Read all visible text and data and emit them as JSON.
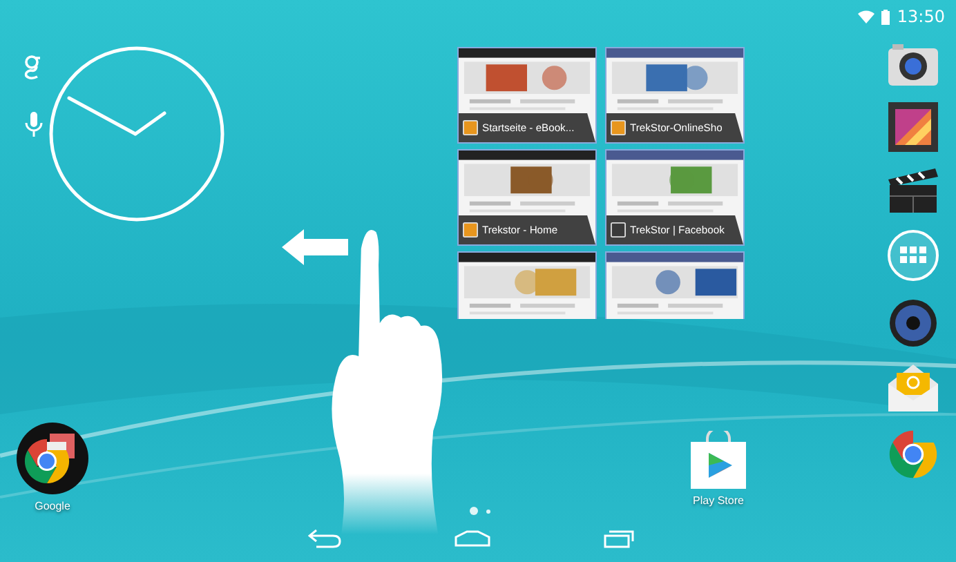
{
  "status_bar": {
    "time": "13:50"
  },
  "recent_apps": [
    {
      "title": "Startseite - eBook...",
      "color": "#e8961e",
      "kind": "picture"
    },
    {
      "title": "TrekStor-OnlineSho",
      "color": "#e8961e",
      "kind": "picture"
    },
    {
      "title": "Trekstor - Home",
      "color": "#e8961e",
      "kind": "picture"
    },
    {
      "title": "TrekStor | Facebook",
      "color": "#3a3a3a",
      "kind": "picture"
    },
    {
      "kind": "picture"
    },
    {
      "kind": "picture"
    }
  ],
  "dock": [
    {
      "kind": "camera"
    },
    {
      "kind": "gallery"
    },
    {
      "kind": "video"
    },
    {
      "kind": "apps"
    },
    {
      "kind": "music"
    },
    {
      "kind": "email"
    },
    {
      "kind": "browser"
    }
  ],
  "desktop_apps": [
    {
      "label": "Google",
      "kind": "folder"
    },
    {
      "label": "Play Store",
      "kind": "store"
    }
  ],
  "pages": [
    {
      "selected": true
    },
    {
      "selected": false
    }
  ]
}
